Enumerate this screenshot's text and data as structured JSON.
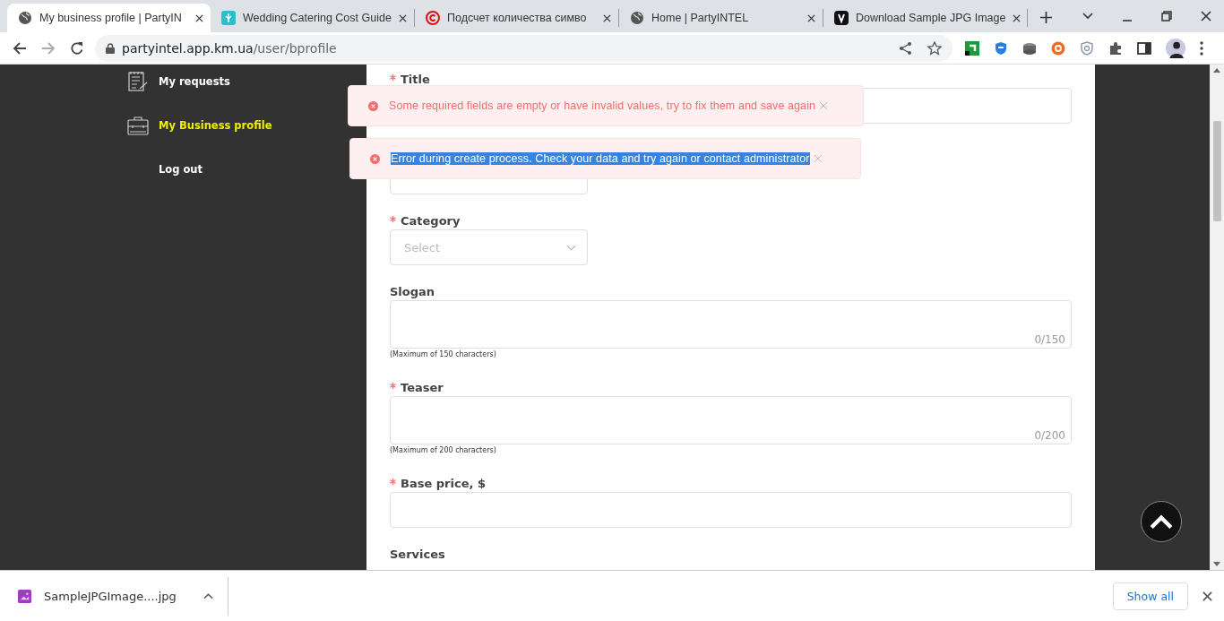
{
  "tabs": [
    {
      "title": "My business profile | PartyIN",
      "selected": true
    },
    {
      "title": "Wedding Catering Cost Guide",
      "selected": false
    },
    {
      "title": "Подсчет количества симво",
      "selected": false
    },
    {
      "title": "Home | PartyINTEL",
      "selected": false
    },
    {
      "title": "Download Sample JPG Image",
      "selected": false
    }
  ],
  "address": {
    "host": "partyintel.app.km.ua",
    "path": "/user/bprofile"
  },
  "sidebar": {
    "items": [
      {
        "label": "My requests",
        "selected": false
      },
      {
        "label": "My Business profile",
        "selected": true
      },
      {
        "label": "Log out",
        "selected": false
      }
    ]
  },
  "form": {
    "fields": [
      {
        "label": "Title",
        "required": true,
        "kind": "text"
      },
      {
        "kind": "select"
      },
      {
        "label": "Category",
        "required": true,
        "kind": "select",
        "placeholder": "Select"
      },
      {
        "label": "Slogan",
        "required": false,
        "kind": "textarea",
        "counter": "0/150",
        "hint": "(Maximum of 150 characters)"
      },
      {
        "label": "Teaser",
        "required": true,
        "kind": "textarea",
        "counter": "0/200",
        "hint": "(Maximum of 200 characters)"
      },
      {
        "label": "Base price, $",
        "required": true,
        "kind": "text"
      },
      {
        "label": "Services",
        "required": false,
        "kind": "none"
      }
    ]
  },
  "toasts": [
    {
      "message": "Some required fields are empty or have invalid values, try to fix them and save again",
      "text_selected": false
    },
    {
      "message": "Error during create process. Check your data and try again or contact administrator",
      "text_selected": true
    }
  ],
  "downloads": {
    "items": [
      {
        "filename": "SampleJPGImage....jpg"
      }
    ],
    "show_all": "Show all"
  }
}
